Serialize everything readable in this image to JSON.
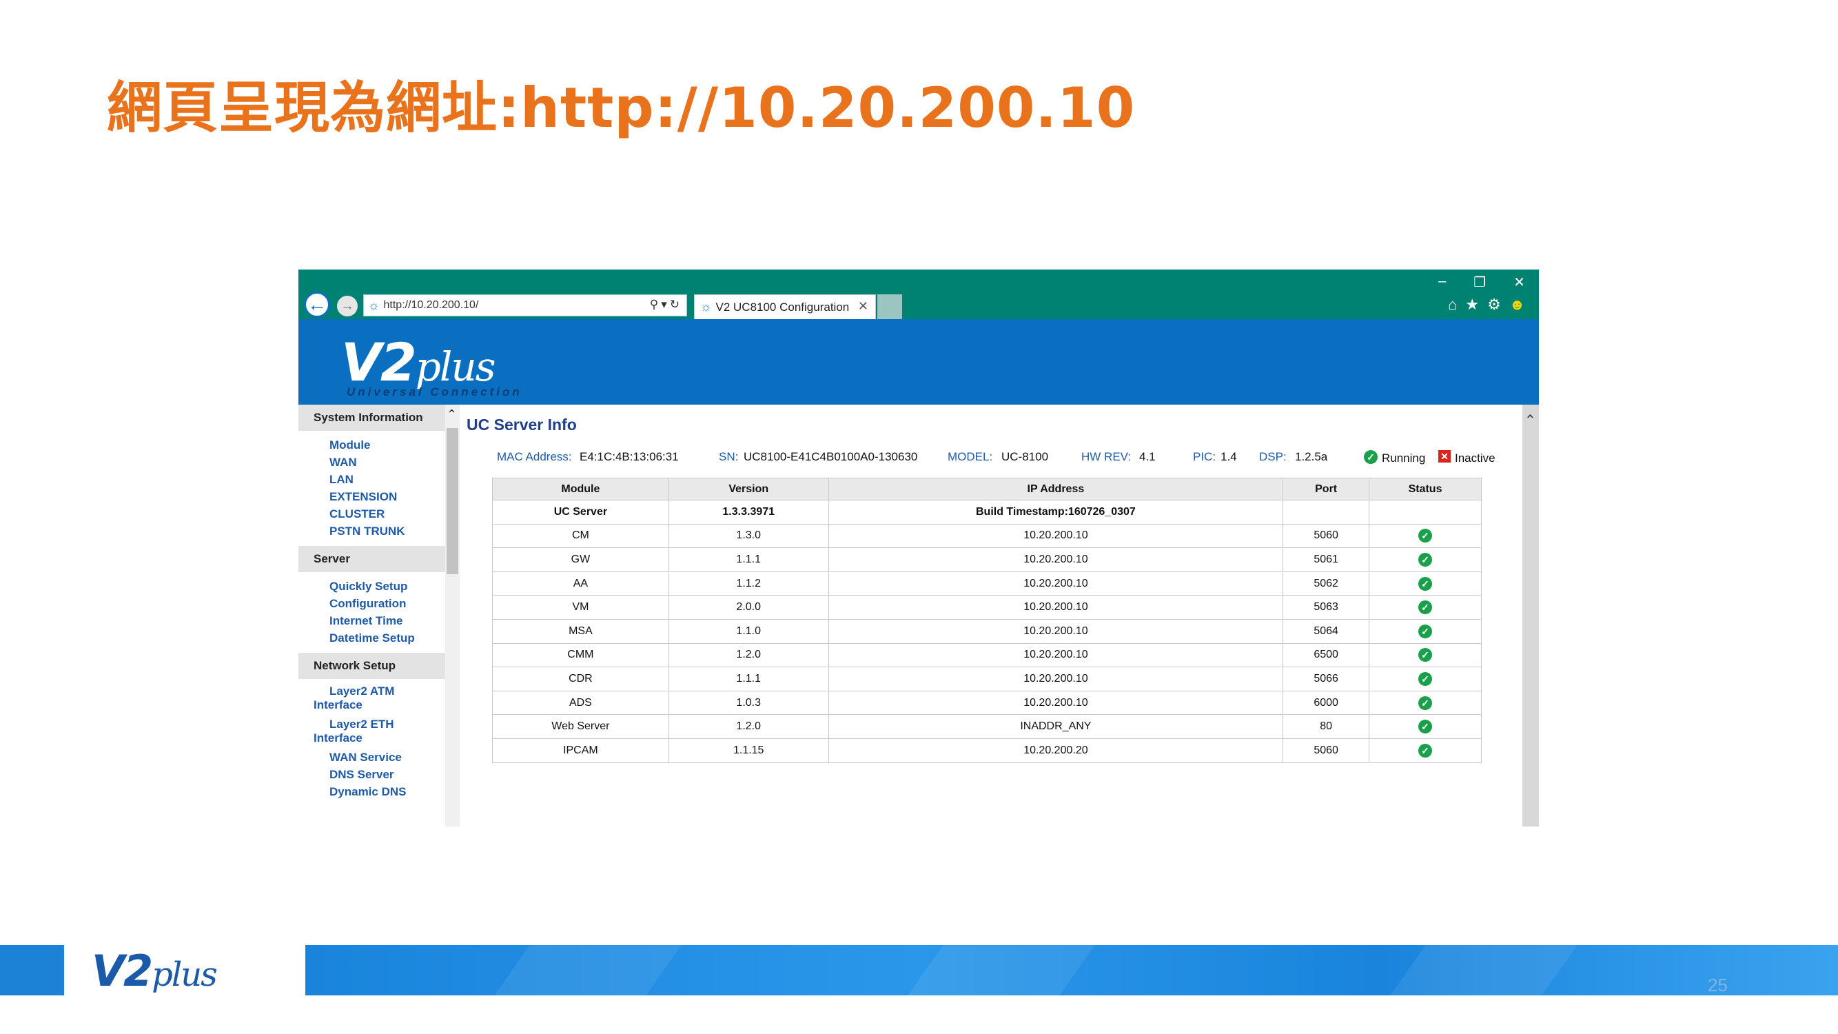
{
  "slide": {
    "title": "網頁呈現為網址:http://10.20.200.10",
    "page_number": "25",
    "footer_logo": {
      "main": "V2",
      "script": "plus"
    }
  },
  "browser": {
    "address": "http://10.20.200.10/",
    "tab_title": "V2 UC8100 Configuration",
    "window_controls": [
      "–",
      "❐",
      "✕"
    ],
    "toolbar_icons": [
      "home-icon",
      "favorites-icon",
      "settings-icon",
      "feedback-icon"
    ]
  },
  "banner": {
    "logo_main": "V2",
    "logo_script": "plus",
    "logo_tagline": "Universal Connection"
  },
  "sidebar": {
    "groups": [
      {
        "label": "System Information",
        "items": [
          "Module",
          "WAN",
          "LAN",
          "EXTENSION",
          "CLUSTER",
          "PSTN TRUNK"
        ]
      },
      {
        "label": "Server",
        "items": [
          "Quickly Setup",
          "Configuration",
          "Internet Time",
          "Datetime Setup"
        ]
      },
      {
        "label": "Network Setup",
        "items": [
          "Layer2 ATM Interface",
          "Layer2 ETH Interface",
          "WAN Service",
          "DNS Server",
          "Dynamic DNS"
        ]
      }
    ]
  },
  "main": {
    "title": "UC Server Info",
    "info": {
      "mac_label": "MAC Address:",
      "mac": "E4:1C:4B:13:06:31",
      "sn_label": "SN:",
      "sn": "UC8100-E41C4B0100A0-130630",
      "model_label": "MODEL:",
      "model": "UC-8100",
      "hw_label": "HW REV:",
      "hw": "4.1",
      "pic_label": "PIC:",
      "pic": "1.4",
      "dsp_label": "DSP:",
      "dsp": "1.2.5a",
      "running_label": "Running",
      "inactive_label": "Inactive"
    },
    "table": {
      "headers": [
        "Module",
        "Version",
        "IP Address",
        "Port",
        "Status"
      ],
      "summary": {
        "module": "UC Server",
        "version": "1.3.3.3971",
        "ip": "Build Timestamp:160726_0307"
      },
      "rows": [
        {
          "module": "CM",
          "version": "1.3.0",
          "ip": "10.20.200.10",
          "port": "5060",
          "status": "running"
        },
        {
          "module": "GW",
          "version": "1.1.1",
          "ip": "10.20.200.10",
          "port": "5061",
          "status": "running"
        },
        {
          "module": "AA",
          "version": "1.1.2",
          "ip": "10.20.200.10",
          "port": "5062",
          "status": "running"
        },
        {
          "module": "VM",
          "version": "2.0.0",
          "ip": "10.20.200.10",
          "port": "5063",
          "status": "running"
        },
        {
          "module": "MSA",
          "version": "1.1.0",
          "ip": "10.20.200.10",
          "port": "5064",
          "status": "running"
        },
        {
          "module": "CMM",
          "version": "1.2.0",
          "ip": "10.20.200.10",
          "port": "6500",
          "status": "running"
        },
        {
          "module": "CDR",
          "version": "1.1.1",
          "ip": "10.20.200.10",
          "port": "5066",
          "status": "running"
        },
        {
          "module": "ADS",
          "version": "1.0.3",
          "ip": "10.20.200.10",
          "port": "6000",
          "status": "running"
        },
        {
          "module": "Web Server",
          "version": "1.2.0",
          "ip": "INADDR_ANY",
          "port": "80",
          "status": "running"
        },
        {
          "module": "IPCAM",
          "version": "1.1.15",
          "ip": "10.20.200.20",
          "port": "5060",
          "status": "running"
        }
      ]
    }
  },
  "colors": {
    "title_orange": "#e8731c",
    "titlebar_teal": "#008272",
    "banner_blue": "#0a6fc0",
    "link_blue": "#1f5aa6",
    "status_green": "#1aa04a",
    "status_red": "#d9261c"
  }
}
